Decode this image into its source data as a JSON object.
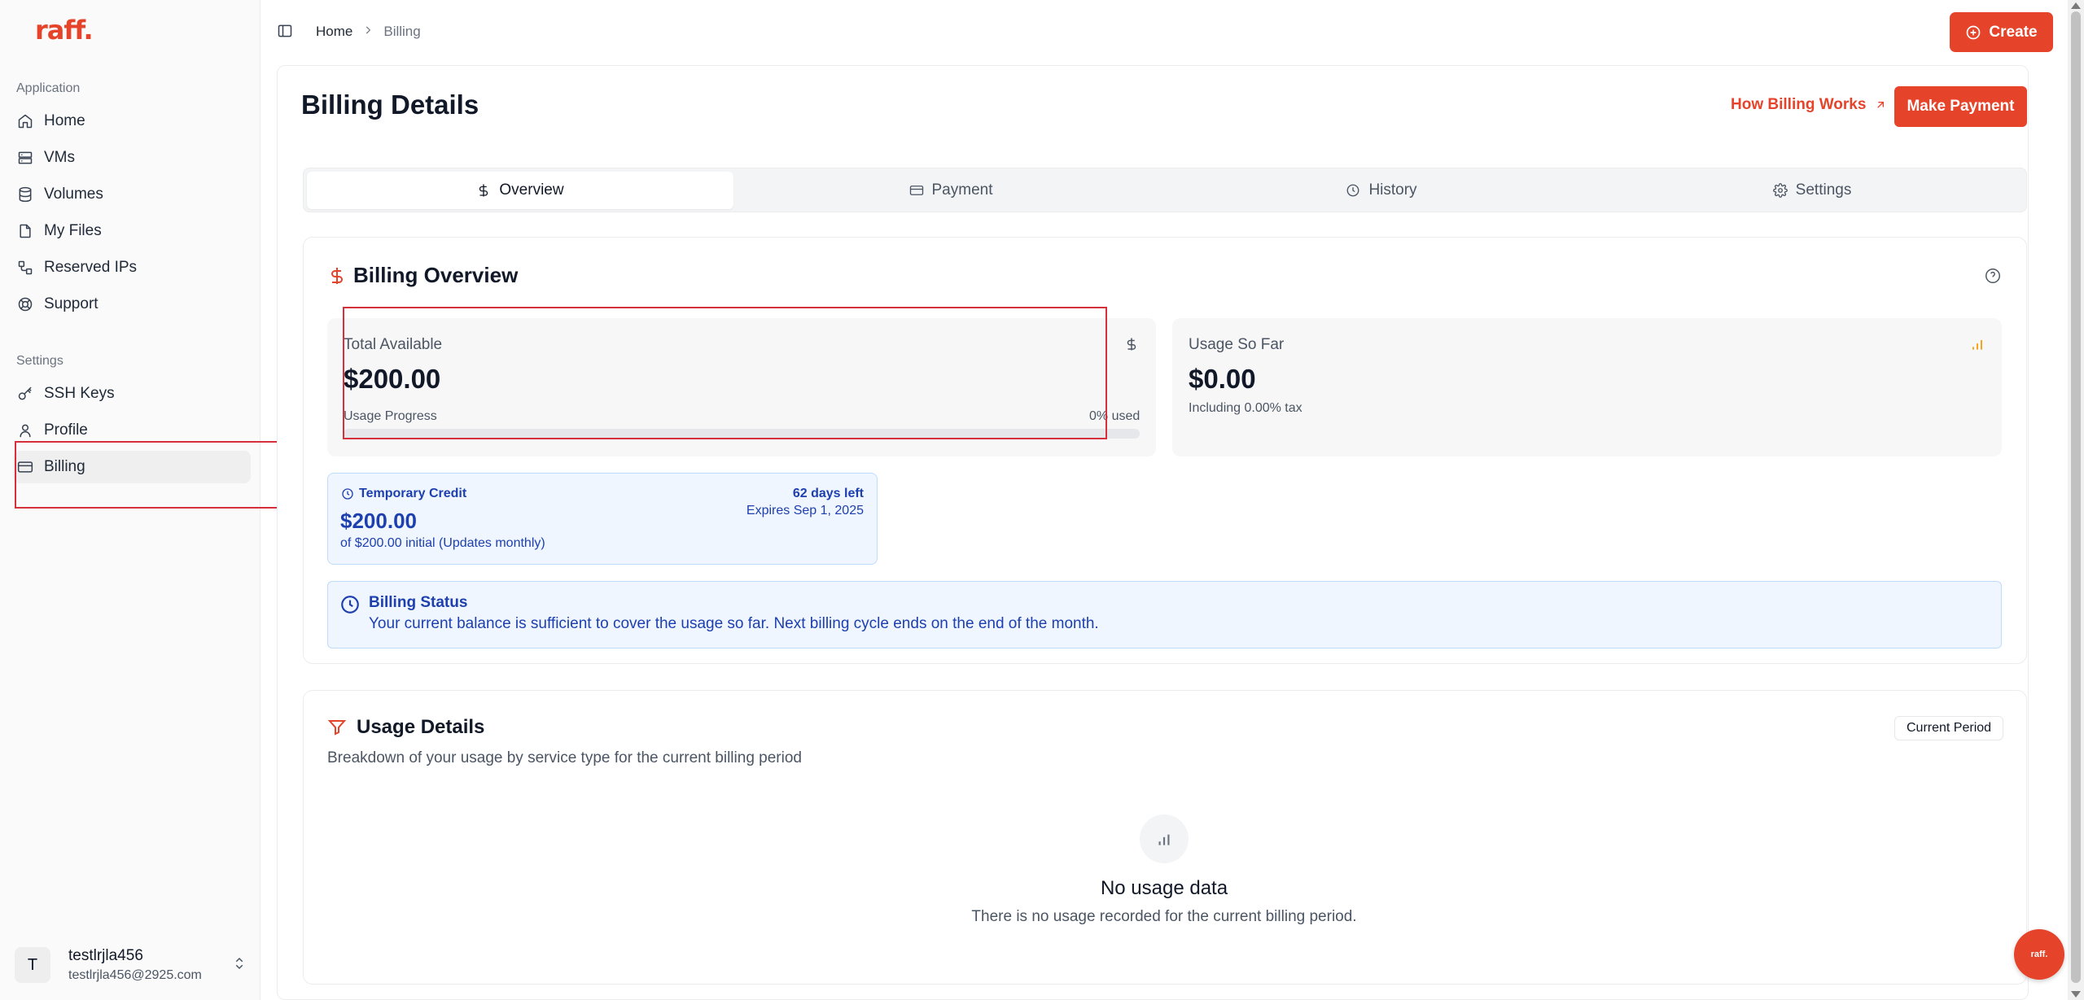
{
  "brand": {
    "logo": "raff.",
    "accent": "#e5432a"
  },
  "sidebar": {
    "groups": [
      {
        "label": "Application",
        "items": [
          {
            "label": "Home",
            "icon": "home-icon"
          },
          {
            "label": "VMs",
            "icon": "server-icon"
          },
          {
            "label": "Volumes",
            "icon": "database-icon"
          },
          {
            "label": "My Files",
            "icon": "file-icon"
          },
          {
            "label": "Reserved IPs",
            "icon": "network-icon"
          },
          {
            "label": "Support",
            "icon": "lifebuoy-icon"
          }
        ]
      },
      {
        "label": "Settings",
        "items": [
          {
            "label": "SSH Keys",
            "icon": "key-icon"
          },
          {
            "label": "Profile",
            "icon": "user-icon"
          },
          {
            "label": "Billing",
            "icon": "credit-card-icon"
          }
        ]
      }
    ],
    "active_item": "Billing",
    "user": {
      "initial": "T",
      "name": "testlrjla456",
      "email": "testlrjla456@2925.com"
    }
  },
  "topbar": {
    "breadcrumb": {
      "home": "Home",
      "current": "Billing"
    },
    "create_label": "Create"
  },
  "page": {
    "title": "Billing Details",
    "how_link": "How Billing Works",
    "payment_button": "Make Payment"
  },
  "tabs": [
    {
      "label": "Overview",
      "icon": "dollar-icon",
      "active": true
    },
    {
      "label": "Payment",
      "icon": "credit-card-icon",
      "active": false
    },
    {
      "label": "History",
      "icon": "clock-icon",
      "active": false
    },
    {
      "label": "Settings",
      "icon": "gear-icon",
      "active": false
    }
  ],
  "overview": {
    "title": "Billing Overview",
    "total": {
      "label": "Total Available",
      "value": "$200.00",
      "progress_label": "Usage Progress",
      "progress_text": "0% used",
      "progress_fraction": 0
    },
    "usage": {
      "label": "Usage So Far",
      "value": "$0.00",
      "tax_note": "Including 0.00% tax"
    },
    "credit": {
      "label": "Temporary Credit",
      "days_left": "62 days left",
      "expires": "Expires Sep 1, 2025",
      "amount": "$200.00",
      "note": "of $200.00 initial (Updates monthly)"
    },
    "status": {
      "title": "Billing Status",
      "message": "Your current balance is sufficient to cover the usage so far. Next billing cycle ends on the end of the month."
    }
  },
  "usage_details": {
    "title": "Usage Details",
    "subtitle": "Breakdown of your usage by service type for the current billing period",
    "badge": "Current Period",
    "empty_title": "No usage data",
    "empty_message": "There is no usage recorded for the current billing period."
  },
  "fab_label": "raff."
}
